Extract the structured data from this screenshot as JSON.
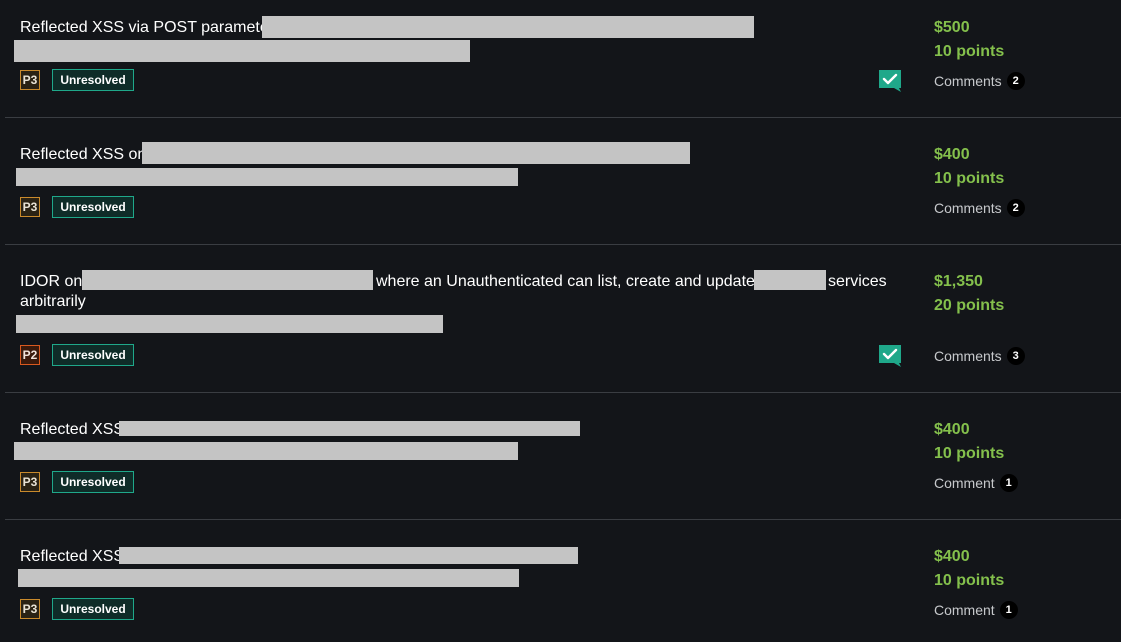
{
  "reports": [
    {
      "title_prefix": "Reflected XSS via POST parameter",
      "priority": "P3",
      "status": "Unresolved",
      "bounty": "$500",
      "points": "10 points",
      "comments_label": "Comments",
      "comments_count": "2",
      "has_check": true
    },
    {
      "title_prefix": "Reflected XSS on",
      "priority": "P3",
      "status": "Unresolved",
      "bounty": "$400",
      "points": "10 points",
      "comments_label": "Comments",
      "comments_count": "2",
      "has_check": false
    },
    {
      "title_part1": "IDOR on",
      "title_part2": "where an Unauthenticated can list, create and update",
      "title_part3": "services",
      "title_line2": "arbitrarily",
      "priority": "P2",
      "status": "Unresolved",
      "bounty": "$1,350",
      "points": "20 points",
      "comments_label": "Comments",
      "comments_count": "3",
      "has_check": true
    },
    {
      "title_prefix": "Reflected XSS",
      "priority": "P3",
      "status": "Unresolved",
      "bounty": "$400",
      "points": "10 points",
      "comments_label": "Comment",
      "comments_count": "1",
      "has_check": false
    },
    {
      "title_prefix": "Reflected XSS",
      "priority": "P3",
      "status": "Unresolved",
      "bounty": "$400",
      "points": "10 points",
      "comments_label": "Comment",
      "comments_count": "1",
      "has_check": false
    }
  ],
  "icons": {
    "check": "check-comment-icon"
  },
  "colors": {
    "background": "#131519",
    "bounty": "#84c04c",
    "status_border": "#1fa88a",
    "p3_border": "#c98a2c",
    "p2_border": "#d9591f",
    "check_icon": "#1fa88a"
  }
}
